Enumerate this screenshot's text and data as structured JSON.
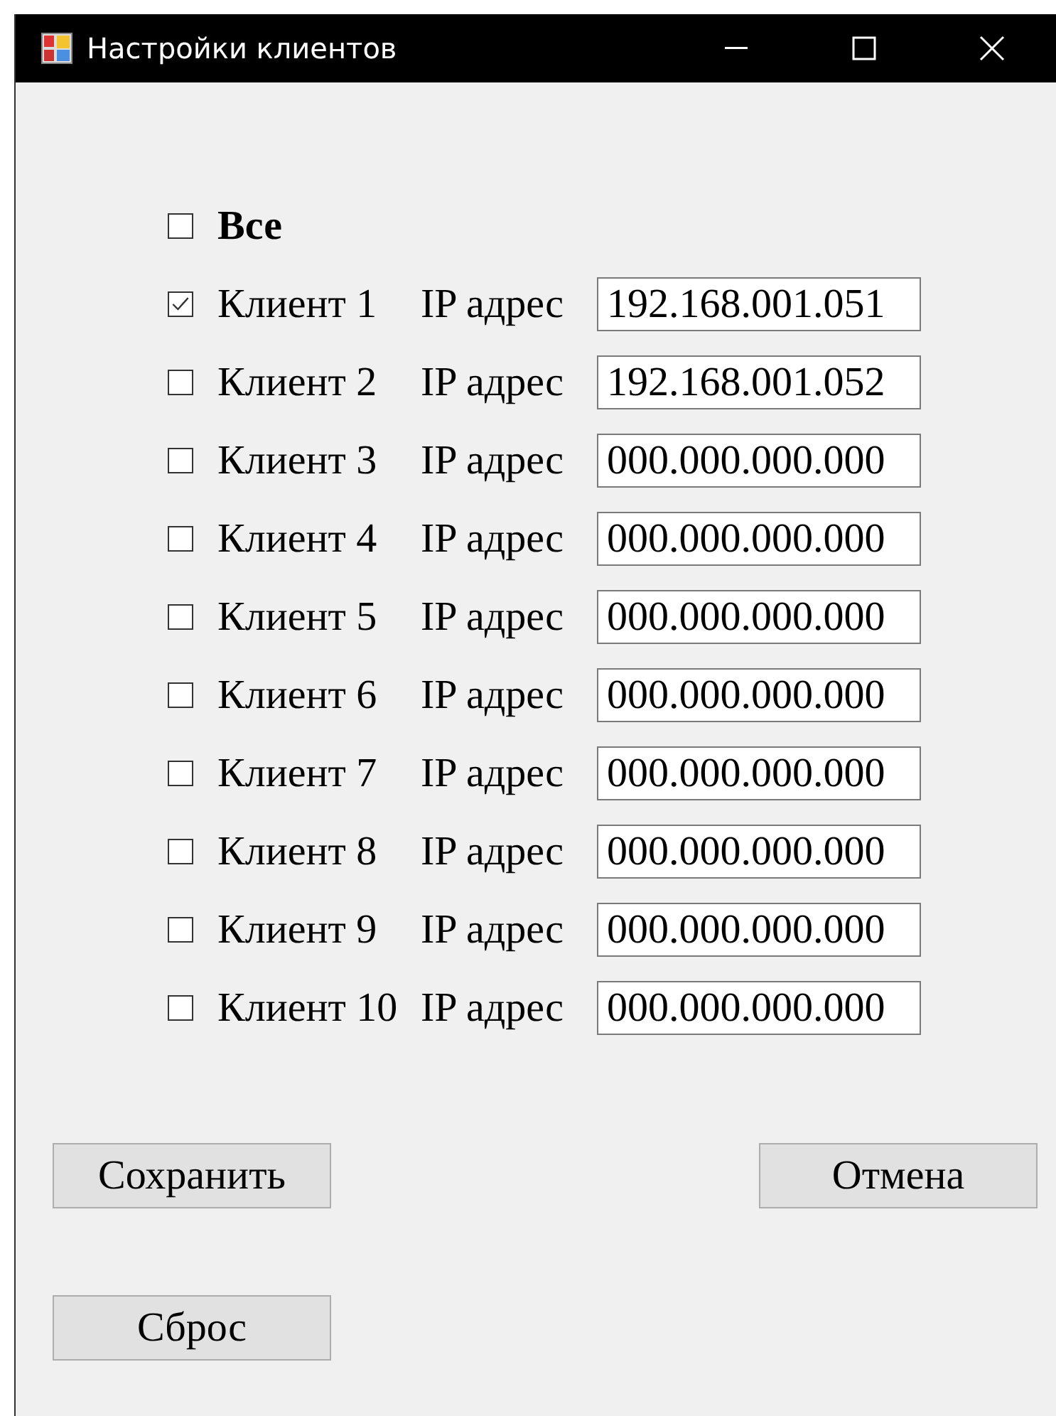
{
  "window": {
    "title": "Настройки клиентов"
  },
  "all": {
    "label": "Все",
    "checked": false
  },
  "clients": [
    {
      "label": "Клиент 1",
      "checked": true,
      "ip_label": "IP адрес",
      "ip": "192.168.001.051"
    },
    {
      "label": "Клиент 2",
      "checked": false,
      "ip_label": "IP адрес",
      "ip": "192.168.001.052"
    },
    {
      "label": "Клиент 3",
      "checked": false,
      "ip_label": "IP адрес",
      "ip": "000.000.000.000"
    },
    {
      "label": "Клиент 4",
      "checked": false,
      "ip_label": "IP адрес",
      "ip": "000.000.000.000"
    },
    {
      "label": "Клиент 5",
      "checked": false,
      "ip_label": "IP адрес",
      "ip": "000.000.000.000"
    },
    {
      "label": "Клиент 6",
      "checked": false,
      "ip_label": "IP адрес",
      "ip": "000.000.000.000"
    },
    {
      "label": "Клиент 7",
      "checked": false,
      "ip_label": "IP адрес",
      "ip": "000.000.000.000"
    },
    {
      "label": "Клиент 8",
      "checked": false,
      "ip_label": "IP адрес",
      "ip": "000.000.000.000"
    },
    {
      "label": "Клиент 9",
      "checked": false,
      "ip_label": "IP адрес",
      "ip": "000.000.000.000"
    },
    {
      "label": "Клиент 10",
      "checked": false,
      "ip_label": "IP адрес",
      "ip": "000.000.000.000"
    }
  ],
  "buttons": {
    "save": "Сохранить",
    "cancel": "Отмена",
    "reset": "Сброс"
  }
}
